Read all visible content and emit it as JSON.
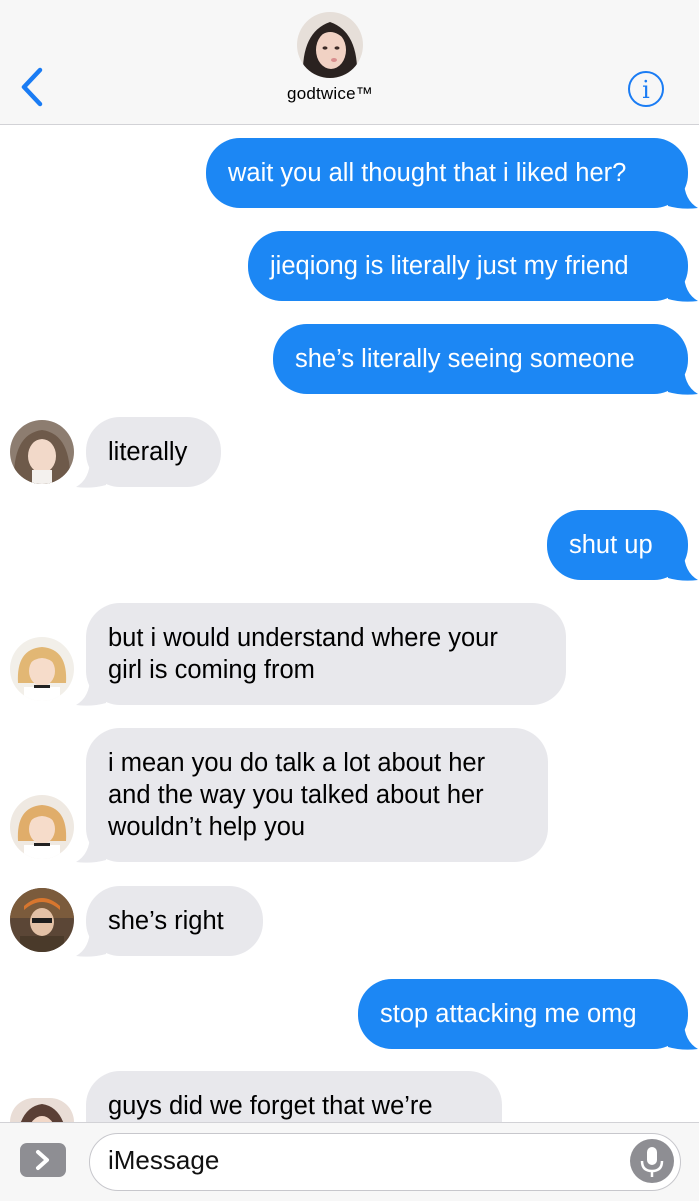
{
  "header": {
    "contact_name": "godtwice™",
    "back_icon": "chevron-left-icon",
    "info_icon": "info-icon"
  },
  "messages": [
    {
      "from": "me",
      "text": "wait you all thought that i liked her?"
    },
    {
      "from": "me",
      "text": "jieqiong is literally just my friend"
    },
    {
      "from": "me",
      "text": "she’s literally seeing someone"
    },
    {
      "from": "member-1",
      "text": "literally"
    },
    {
      "from": "me",
      "text": "shut up"
    },
    {
      "from": "member-2",
      "lines": [
        "but i would understand where your",
        "girl is coming from"
      ]
    },
    {
      "from": "member-2",
      "lines": [
        "i mean you do talk a lot about her",
        "and the way you talked about her",
        "wouldn’t help you"
      ]
    },
    {
      "from": "member-3",
      "text": "she’s right"
    },
    {
      "from": "me",
      "text": "stop attacking me omg"
    },
    {
      "from": "member-4",
      "text": "guys did we forget that we’re"
    }
  ],
  "composer": {
    "placeholder": "iMessage",
    "apps_icon": "chevron-right-icon",
    "mic_icon": "microphone-icon"
  },
  "colors": {
    "sent_bubble": "#1c87f4",
    "received_bubble": "#e8e8ec",
    "accent": "#1a7cf4"
  }
}
